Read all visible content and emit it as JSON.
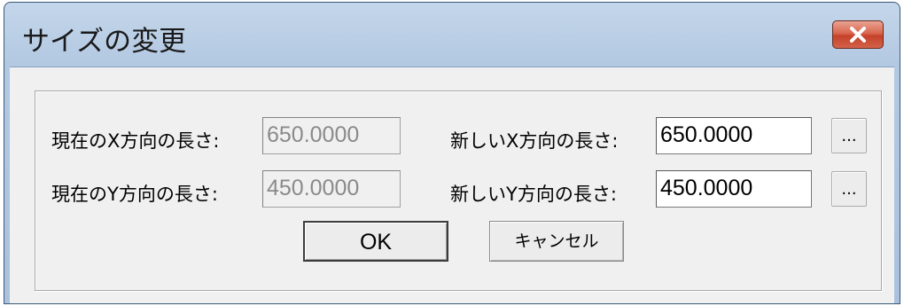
{
  "window": {
    "title": "サイズの変更"
  },
  "current_x": {
    "label": "現在のX方向の長さ:",
    "value": "650.0000"
  },
  "current_y": {
    "label": "現在のY方向の長さ:",
    "value": "450.0000"
  },
  "new_x": {
    "label": "新しいX方向の長さ:",
    "value": "650.0000",
    "browse_label": "..."
  },
  "new_y": {
    "label": "新しいY方向の長さ:",
    "value": "450.0000",
    "browse_label": "..."
  },
  "buttons": {
    "ok": "OK",
    "cancel": "キャンセル"
  },
  "icons": {
    "close": "close-icon"
  },
  "colors": {
    "titlebar": "#b3c9e2",
    "close_button": "#c6412a",
    "client_background": "#f0f0f0"
  }
}
